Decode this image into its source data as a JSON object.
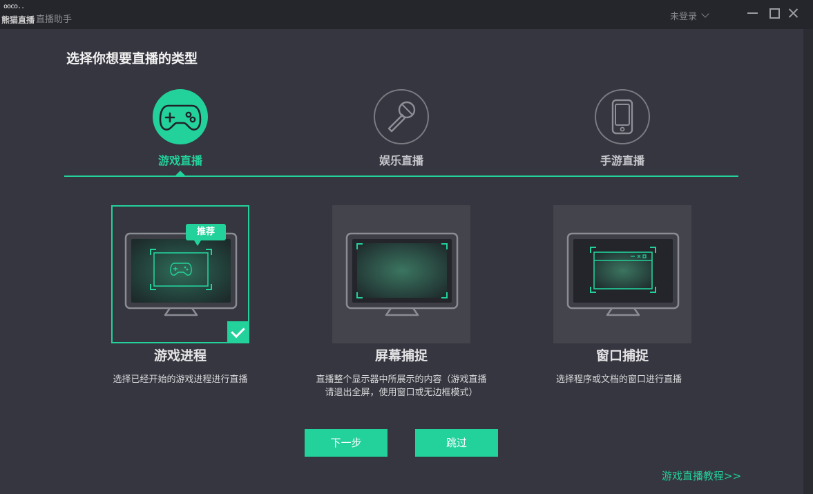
{
  "titlebar": {
    "logo_mark": "ooco..",
    "brand": "熊猫直播",
    "app_name": "直播助手",
    "login_label": "未登录"
  },
  "heading": "选择你想要直播的类型",
  "categories": [
    {
      "label": "游戏直播",
      "icon": "gamepad-icon",
      "active": true
    },
    {
      "label": "娱乐直播",
      "icon": "microphone-icon",
      "active": false
    },
    {
      "label": "手游直播",
      "icon": "phone-icon",
      "active": false
    }
  ],
  "capture_modes": [
    {
      "title": "游戏进程",
      "description": "选择已经开始的游戏进程进行直播",
      "badge": "推荐",
      "selected": true
    },
    {
      "title": "屏幕捕捉",
      "description": "直播整个显示器中所展示的内容（游戏直播请退出全屏，使用窗口或无边框模式）",
      "selected": false
    },
    {
      "title": "窗口捕捉",
      "description": "选择程序或文档的窗口进行直播",
      "selected": false
    }
  ],
  "buttons": {
    "next": "下一步",
    "skip": "跳过"
  },
  "tutorial_link": "游戏直播教程>>",
  "colors": {
    "accent": "#23d19b",
    "content_bg": "#35363f",
    "card_bg": "#43444c"
  }
}
